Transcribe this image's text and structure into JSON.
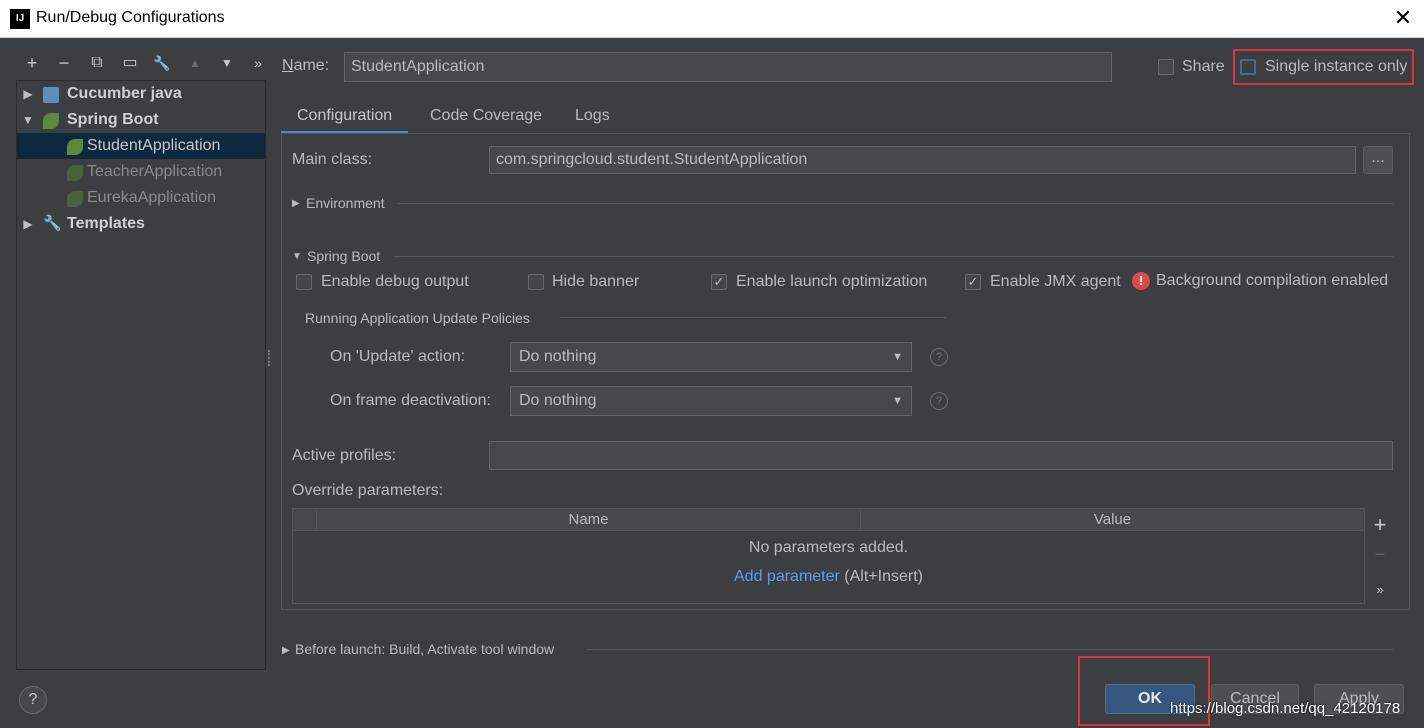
{
  "window": {
    "title": "Run/Debug Configurations",
    "close_glyph": "✕",
    "app_icon_text": "IJ"
  },
  "toolbar": [
    {
      "name": "add-icon",
      "glyph": "+"
    },
    {
      "name": "remove-icon",
      "glyph": "−"
    },
    {
      "name": "copy-icon",
      "glyph": "⧉"
    },
    {
      "name": "save-icon",
      "glyph": "▭"
    },
    {
      "name": "wrench-icon",
      "glyph": "🔧"
    },
    {
      "name": "move-up-icon",
      "glyph": "▲"
    },
    {
      "name": "move-down-icon",
      "glyph": "▼"
    },
    {
      "name": "more-icon",
      "glyph": "»"
    }
  ],
  "tree": {
    "items": [
      {
        "label": "Cucumber java",
        "expanded": false
      },
      {
        "label": "Spring Boot",
        "expanded": true
      },
      {
        "label": "StudentApplication",
        "selected": true
      },
      {
        "label": "TeacherApplication"
      },
      {
        "label": "EurekaApplication"
      },
      {
        "label": "Templates",
        "expanded": false
      }
    ]
  },
  "header": {
    "name_label": "Name:",
    "name_value": "StudentApplication",
    "share_label": "Share",
    "share_checked": false,
    "single_instance_label": "Single instance only",
    "single_instance_checked": false
  },
  "tabs": [
    {
      "label": "Configuration",
      "active": true
    },
    {
      "label": "Code Coverage"
    },
    {
      "label": "Logs"
    }
  ],
  "config": {
    "main_class_label": "Main class:",
    "main_class_value": "com.springcloud.student.StudentApplication",
    "browse_label": "...",
    "environment_label": "Environment",
    "spring_boot_label": "Spring Boot",
    "enable_debug_output": {
      "label": "Enable debug output",
      "checked": false
    },
    "hide_banner": {
      "label": "Hide banner",
      "checked": false
    },
    "enable_launch_optimization": {
      "label": "Enable launch optimization",
      "checked": true
    },
    "enable_jmx_agent": {
      "label": "Enable JMX agent",
      "checked": true
    },
    "background_compilation": "Background compilation enabled",
    "policies_title": "Running Application Update Policies",
    "on_update_label": "On 'Update' action:",
    "on_update_value": "Do nothing",
    "on_frame_label": "On frame deactivation:",
    "on_frame_value": "Do nothing",
    "help_glyph": "?",
    "active_profiles_label": "Active profiles:",
    "active_profiles_value": "",
    "override_label": "Override parameters:",
    "table": {
      "columns": [
        "Name",
        "Value"
      ],
      "empty_text": "No parameters added.",
      "add_link": "Add parameter",
      "add_hint": "(Alt+Insert)"
    },
    "side_add": "+",
    "side_remove": "−",
    "side_more": "»"
  },
  "before_launch": "Before launch: Build, Activate tool window",
  "footer": {
    "help": "?",
    "ok": "OK",
    "cancel": "Cancel",
    "apply": "Apply",
    "watermark": "https://blog.csdn.net/qq_42120178"
  },
  "colors": {
    "accent": "#4a88c7",
    "highlight": "#e0333a",
    "link": "#589df6",
    "background": "#3c3f41"
  }
}
